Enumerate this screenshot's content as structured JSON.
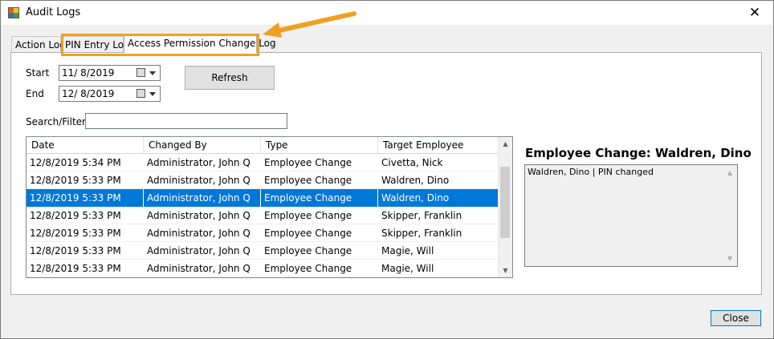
{
  "window": {
    "title": "Audit Logs",
    "close_glyph": "✕"
  },
  "tabs": [
    {
      "label": "Action Log"
    },
    {
      "label": "PIN Entry Log"
    },
    {
      "label": "Access Permission Change Log"
    }
  ],
  "filters": {
    "start_label": "Start",
    "start_value": "11/  8/2019",
    "end_label": "End",
    "end_value": "12/  8/2019",
    "refresh_label": "Refresh",
    "search_label": "Search/Filter",
    "search_value": ""
  },
  "grid": {
    "columns": [
      "Date",
      "Changed By",
      "Type",
      "Target Employee"
    ],
    "rows": [
      [
        "12/8/2019 5:34 PM",
        "Administrator, John Q",
        "Employee Change",
        "Civetta, Nick"
      ],
      [
        "12/8/2019 5:33 PM",
        "Administrator, John Q",
        "Employee Change",
        "Waldren, Dino"
      ],
      [
        "12/8/2019 5:33 PM",
        "Administrator, John Q",
        "Employee Change",
        "Waldren, Dino"
      ],
      [
        "12/8/2019 5:33 PM",
        "Administrator, John Q",
        "Employee Change",
        "Skipper, Franklin"
      ],
      [
        "12/8/2019 5:33 PM",
        "Administrator, John Q",
        "Employee Change",
        "Skipper, Franklin"
      ],
      [
        "12/8/2019 5:33 PM",
        "Administrator, John Q",
        "Employee Change",
        "Magie, Will"
      ],
      [
        "12/8/2019 5:33 PM",
        "Administrator, John Q",
        "Employee Change",
        "Magie, Will"
      ]
    ],
    "selected_row": 2
  },
  "detail": {
    "title": "Employee Change: Waldren, Dino",
    "text": "Waldren, Dino | PIN changed"
  },
  "footer": {
    "close_label": "Close"
  },
  "colors": {
    "selection": "#0078d7",
    "annotation": "#f0a020"
  }
}
